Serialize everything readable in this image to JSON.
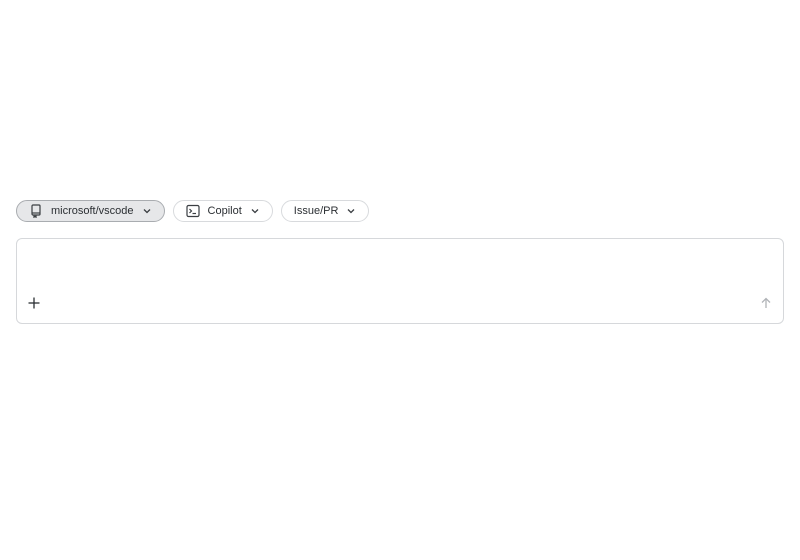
{
  "toolbar": {
    "repo_chip": {
      "label": "microsoft/vscode",
      "icon": "repo-icon",
      "selected": true
    },
    "agent_chip": {
      "label": "Copilot",
      "icon": "terminal-icon"
    },
    "type_chip": {
      "label": "Issue/PR"
    }
  },
  "composer": {
    "value": "",
    "placeholder": "",
    "add_icon": "plus-icon",
    "send_icon": "arrow-up-icon"
  },
  "colors": {
    "chip_border": "#d8dadd",
    "chip_selected_bg": "#e6e7e9",
    "text": "#2b2f33",
    "muted_icon": "#b0b3b7"
  }
}
